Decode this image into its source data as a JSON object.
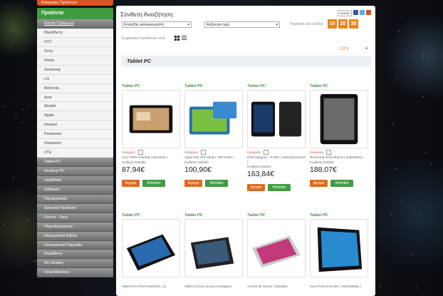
{
  "colors": {
    "green": "#3f9d3f",
    "orange": "#e06a1c",
    "pp": "#e8871e"
  },
  "sidebar": {
    "top_label": "Κατηγορίες Προϊόντων",
    "header": "Προϊόντα",
    "items": [
      {
        "label": "Κινητά Τηλέφωνα",
        "style": "dark first"
      },
      {
        "label": "BlackBerry",
        "style": ""
      },
      {
        "label": "HTC",
        "style": ""
      },
      {
        "label": "Sony",
        "style": ""
      },
      {
        "label": "Nokia",
        "style": ""
      },
      {
        "label": "Samsung",
        "style": ""
      },
      {
        "label": "LG",
        "style": ""
      },
      {
        "label": "Motorola",
        "style": ""
      },
      {
        "label": "Acer",
        "style": ""
      },
      {
        "label": "Alcatel",
        "style": ""
      },
      {
        "label": "Apple",
        "style": ""
      },
      {
        "label": "Huawei",
        "style": ""
      },
      {
        "label": "Panasonic",
        "style": ""
      },
      {
        "label": "Viewsonic",
        "style": ""
      },
      {
        "label": "ZTE",
        "style": ""
      },
      {
        "label": "Tablet PC",
        "style": "dark"
      },
      {
        "label": "Desktop PC",
        "style": "dark"
      },
      {
        "label": "HardWare",
        "style": "dark"
      },
      {
        "label": "Software",
        "style": "dark"
      },
      {
        "label": "Περιφερειακά",
        "style": "dark"
      },
      {
        "label": "Δικτυακά Προϊόντα",
        "style": "dark"
      },
      {
        "label": "Εικόνα - Ήχος",
        "style": "dark"
      },
      {
        "label": "Παιχνιδομηχανές",
        "style": "dark"
      },
      {
        "label": "Ηλεκτρονικά Βιβλία",
        "style": "dark"
      },
      {
        "label": "Ηλεκτρονικά Παιχνίδια",
        "style": "dark"
      },
      {
        "label": "RaspBerry",
        "style": "dark"
      },
      {
        "label": "RC Models",
        "style": "dark"
      },
      {
        "label": "SmartWatches",
        "style": "dark"
      }
    ]
  },
  "main": {
    "title": "Σύνθετη Αναζήτηση",
    "share_label": "SHARE",
    "category_select": "Επιλέξτε κατασκευαστή",
    "sort_select": "Αύξουσα τιμή",
    "perpage_label": "Προϊόντα ανά σελίδα",
    "perpage_options": [
      "10",
      "20",
      "30"
    ],
    "view_label": "Εμφάνιση προϊόντων ανά",
    "pager": "1 2 3",
    "plus": "+",
    "section_title": "Tablet PC"
  },
  "products": [
    {
      "category": "Tablet PC",
      "compare": "Σύγκριση",
      "name": "Cryo PEDI KidsTab ( 5610030 )",
      "code": "Κωδικός:516389",
      "price": "87,94€",
      "buy": "Αγορά",
      "wish": "Wishlist",
      "device": "land-black"
    },
    {
      "category": "Tablet PC",
      "compare": "Σύγκριση",
      "name": "AllpenTab TB7A0HB ( TB7A0HB )",
      "code": "Κωδικός:516354",
      "price": "100,90€",
      "buy": "Αγορά",
      "wish": "Wishlist",
      "device": "land-blue"
    },
    {
      "category": "Tablet PC",
      "compare": "Σύγκριση",
      "name": "Pelit Galapad 7.0 WiFi ( 8631110111015 )",
      "code": "Κωδικός:516414",
      "price": "163,84€",
      "buy": "Αγορά",
      "wish": "Wishlist",
      "device": "duo"
    },
    {
      "category": "Tablet PC",
      "compare": "Σύγκριση",
      "name": "TechniSat TechniPad 8 ( 0000/9005 )",
      "code": "Κωδικός:516353",
      "price": "188,07€",
      "buy": "Αγορά",
      "wish": "Wishlist",
      "device": "portrait"
    },
    {
      "category": "Tablet PC",
      "compare": "",
      "name": "Tablet PoV PROTAB26XXL 10",
      "code": "",
      "price": "",
      "buy": "",
      "wish": "",
      "device": "angle-black"
    },
    {
      "category": "Tablet PC",
      "compare": "",
      "name": "Tablet Archos Arnova Familypad",
      "code": "",
      "price": "",
      "buy": "",
      "wish": "",
      "device": "angle-dark"
    },
    {
      "category": "Tablet PC",
      "compare": "",
      "name": "Archos 80 Xenon ( 502386 )",
      "code": "",
      "price": "",
      "buy": "",
      "wish": "",
      "device": "angle-pink"
    },
    {
      "category": "Tablet PC",
      "compare": "",
      "name": "Xoro PAD 9716 DR ( XOR400536 )",
      "code": "",
      "price": "",
      "buy": "",
      "wish": "",
      "device": "angle-color"
    }
  ]
}
